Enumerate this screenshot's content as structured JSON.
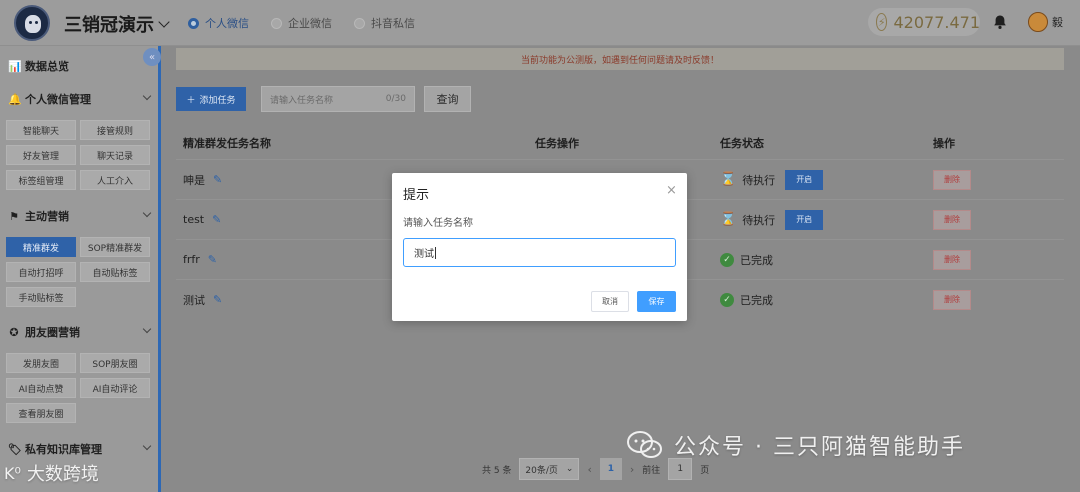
{
  "header": {
    "app_title": "三销冠演示",
    "radios": [
      {
        "label": "个人微信",
        "active": true
      },
      {
        "label": "企业微信",
        "active": false
      },
      {
        "label": "抖音私信",
        "active": false
      }
    ],
    "balance": "42077.471",
    "user_name": "毅"
  },
  "sidebar": {
    "sections": [
      {
        "title": "数据总览",
        "icon": "bar-chart-icon",
        "items": []
      },
      {
        "title": "个人微信管理",
        "icon": "bell-icon",
        "items": [
          "智能聊天",
          "接管规则",
          "好友管理",
          "聊天记录",
          "标签组管理",
          "人工介入"
        ]
      },
      {
        "title": "主动营销",
        "icon": "flag-icon",
        "items": [
          "精准群发",
          "SOP精准群发",
          "自动打招呼",
          "自动贴标签",
          "手动贴标签"
        ]
      },
      {
        "title": "朋友圈营销",
        "icon": "aperture-icon",
        "items": [
          "发朋友圈",
          "SOP朋友圈",
          "AI自动点赞",
          "AI自动评论",
          "查看朋友圈"
        ]
      },
      {
        "title": "私有知识库管理",
        "icon": "tag-icon",
        "items": []
      }
    ],
    "active_item": "精准群发"
  },
  "main": {
    "notice": "当前功能为公测版，如遇到任何问题请及时反馈！",
    "add_task_label": "添加任务",
    "search": {
      "placeholder": "请输入任务名称",
      "count": "0/30"
    },
    "query_label": "查询",
    "columns": [
      "精准群发任务名称",
      "任务操作",
      "任务状态",
      "操作"
    ],
    "rows": [
      {
        "name": "呻是",
        "status": "待执行",
        "pending": true,
        "start_label": "开启",
        "delete_label": "删除"
      },
      {
        "name": "test",
        "status": "待执行",
        "pending": true,
        "start_label": "开启",
        "delete_label": "删除"
      },
      {
        "name": "frfr",
        "status": "已完成",
        "pending": false,
        "start_label": "",
        "delete_label": "删除"
      },
      {
        "name": "测试",
        "status": "已完成",
        "pending": false,
        "start_label": "",
        "delete_label": "删除"
      }
    ],
    "pagination": {
      "total": "共 5 条",
      "page_size": "20条/页",
      "current": "1",
      "goto_prefix": "前往",
      "goto_value": "1",
      "goto_suffix": "页"
    }
  },
  "modal": {
    "title": "提示",
    "close": "×",
    "label": "请输入任务名称",
    "value": "测试",
    "cancel_label": "取消",
    "save_label": "保存"
  },
  "watermarks": {
    "right": "公众号 · 三只阿猫智能助手",
    "left": "大数跨境"
  },
  "colors": {
    "primary": "#409eff",
    "sidebar_accent": "#2d68b5",
    "danger": "#b03a3a"
  }
}
